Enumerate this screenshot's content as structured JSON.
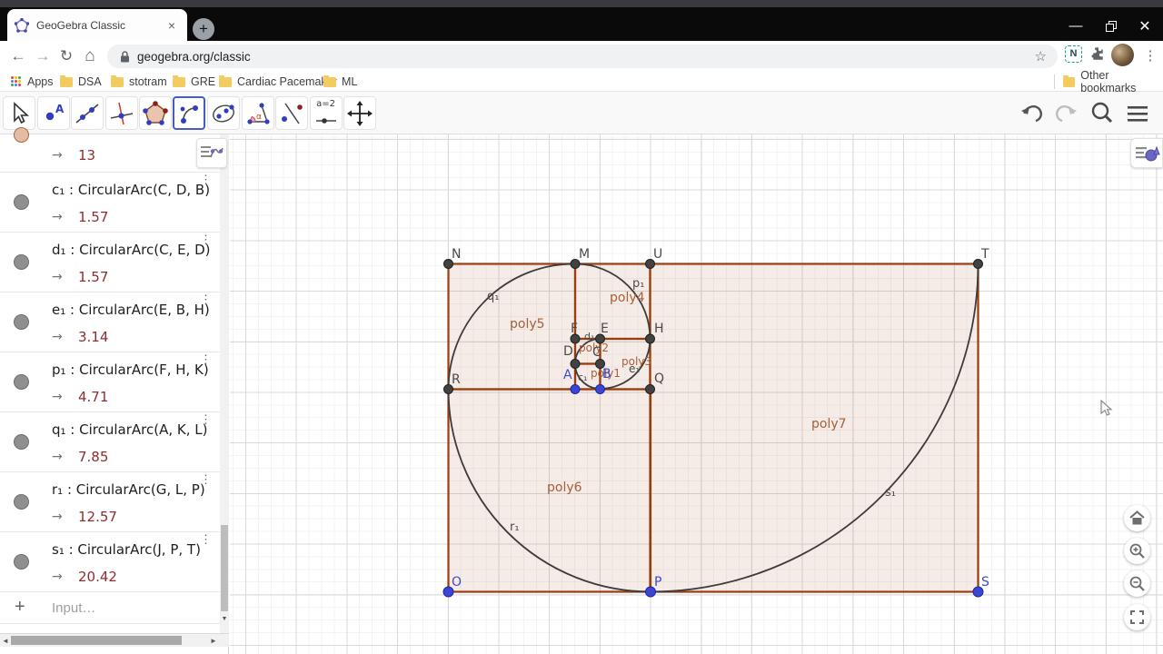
{
  "browser": {
    "tab_title": "GeoGebra Classic",
    "url": "geogebra.org/classic",
    "bookmarks": [
      "Apps",
      "DSA",
      "stotram",
      "GRE",
      "Cardiac Pacemaker",
      "ML"
    ],
    "other_bookmarks": "Other bookmarks",
    "extension_n_label": "N"
  },
  "glyphs": {
    "close_tab": "×",
    "new_tab": "+",
    "minimize": "—",
    "close_window": "✕",
    "back": "←",
    "forward": "→",
    "reload": "↻",
    "home": "⌂",
    "star": "☆",
    "kebab": "⋮",
    "entry_kebab": "⋮",
    "scroll_left": "◄",
    "scroll_right": "►",
    "scroll_down": "▼",
    "input_plus": "+"
  },
  "toolbar": {
    "tools": [
      "move",
      "point",
      "line",
      "perpendicular-line",
      "polygon",
      "circular-arc",
      "conic",
      "angle",
      "reflect-about-line",
      "slider",
      "move-graphics-view"
    ],
    "selected_tool": "circular-arc",
    "slider_label": "a=2"
  },
  "algebra": {
    "value_prefix": "→",
    "partial_entry": {
      "value": "13"
    },
    "entries": [
      {
        "definition": "c₁ : CircularArc(C, D, B)",
        "value": "1.57"
      },
      {
        "definition": "d₁ : CircularArc(C, E, D)",
        "value": "1.57"
      },
      {
        "definition": "e₁ : CircularArc(E, B, H)",
        "value": "3.14"
      },
      {
        "definition": "p₁ : CircularArc(F, H, K)",
        "value": "4.71"
      },
      {
        "definition": "q₁ : CircularArc(A, K, L)",
        "value": "7.85"
      },
      {
        "definition": "r₁ : CircularArc(G, L, P)",
        "value": "12.57"
      },
      {
        "definition": "s₁ : CircularArc(J, P, T)",
        "value": "20.42"
      }
    ],
    "input_placeholder": "Input…"
  },
  "graphics": {
    "point_labels": {
      "N": "N",
      "M": "M",
      "U": "U",
      "T": "T",
      "R": "R",
      "Q": "Q",
      "O": "O",
      "P": "P",
      "S": "S",
      "F": "F",
      "E": "E",
      "H": "H",
      "D": "D",
      "C": "C",
      "A": "A",
      "B": "B"
    },
    "poly_labels": {
      "poly1": "poly1",
      "poly2": "poly2",
      "poly3": "poly3",
      "poly4": "poly4",
      "poly5": "poly5",
      "poly6": "poly6",
      "poly7": "poly7"
    },
    "arc_labels": {
      "c1": "c₁",
      "d1": "d₁",
      "e1": "e₁",
      "p1": "p₁",
      "q1": "q₁",
      "r1": "r₁",
      "s1": "s₁"
    },
    "colors": {
      "polygon_stroke": "#993d10",
      "polygon_fill": "rgba(153,61,16,0.10)",
      "arc_stroke": "#3c3c3c",
      "black_point": "#424242",
      "blue_point": "#3a46d4",
      "blue_label": "#3d4bcc",
      "poly_label": "#a8603a"
    }
  }
}
